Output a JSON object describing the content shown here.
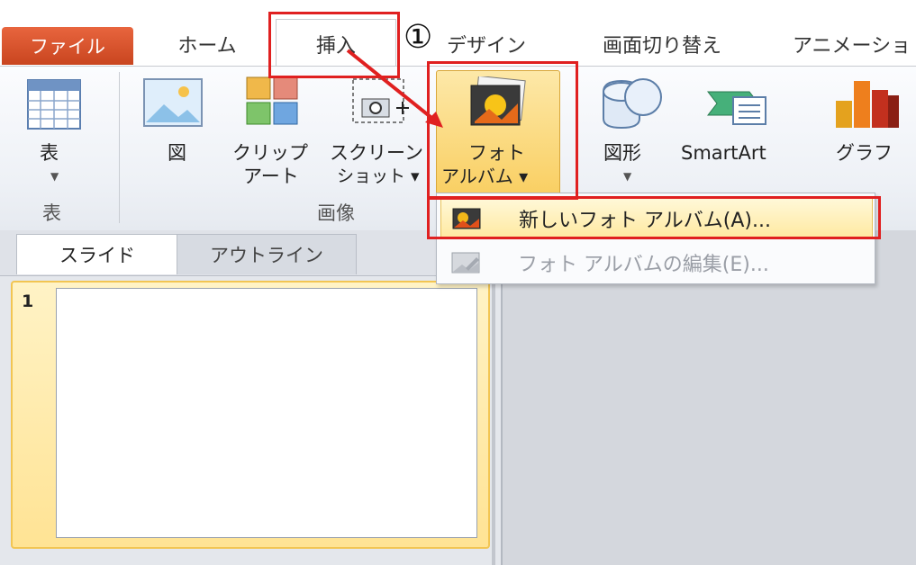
{
  "tabs": {
    "file": "ファイル",
    "home": "ホーム",
    "insert": "挿入",
    "design": "デザイン",
    "transitions": "画面切り替え",
    "animations": "アニメーショ"
  },
  "ribbon": {
    "table_label": "表",
    "table_group": "表",
    "picture_label": "図",
    "clipart_line1": "クリップ",
    "clipart_line2": "アート",
    "screenshot_line1": "スクリーン",
    "screenshot_line2": "ショット ▾",
    "photo_album_line1": "フォト",
    "photo_album_line2": "アルバム ▾",
    "images_group": "画像",
    "shapes_label": "図形",
    "smartart_label": "SmartArt",
    "chart_label": "グラフ"
  },
  "photo_album_menu": {
    "new_album": "新しいフォト アルバム(A)...",
    "edit_album": "フォト アルバムの編集(E)..."
  },
  "panel": {
    "tab_slides": "スライド",
    "tab_outline": "アウトライン",
    "slide_number": "1"
  },
  "annotation": {
    "step_marker": "①",
    "highlight_color": "#e02020"
  }
}
